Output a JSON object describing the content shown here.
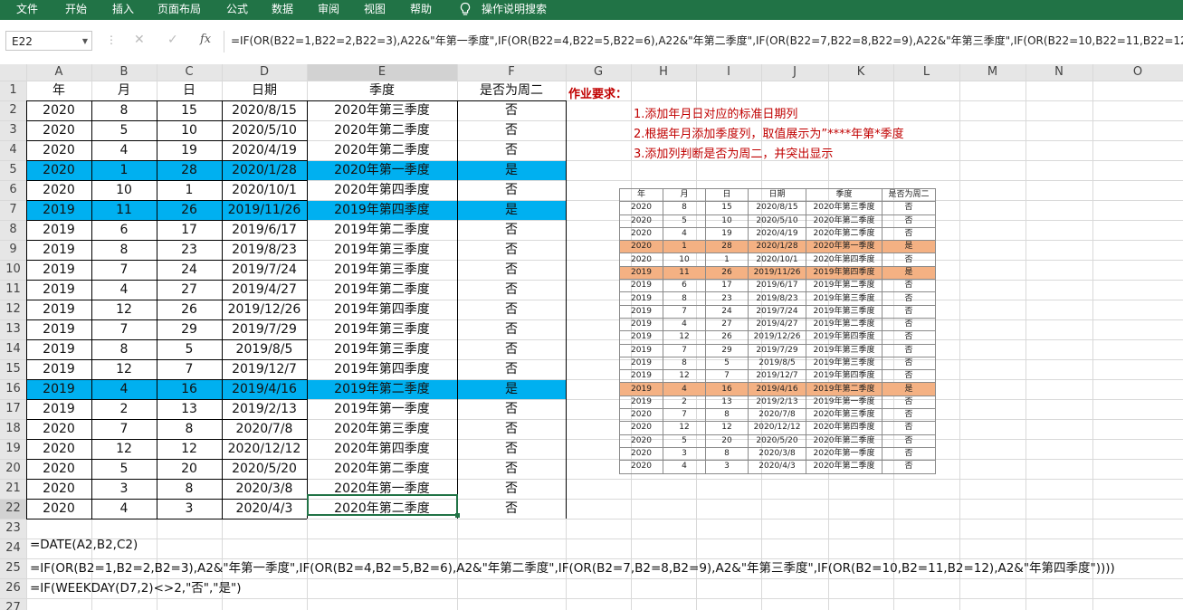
{
  "ribbon": {
    "tabs": [
      "文件",
      "开始",
      "插入",
      "页面布局",
      "公式",
      "数据",
      "审阅",
      "视图",
      "帮助"
    ],
    "tell_me": "操作说明搜索"
  },
  "formula_bar": {
    "name_box": "E22",
    "fx_label": "fx",
    "formula": "=IF(OR(B22=1,B22=2,B22=3),A22&\"年第一季度\",IF(OR(B22=4,B22=5,B22=6),A22&\"年第二季度\",IF(OR(B22=7,B22=8,B22=9),A22&\"年第三季度\",IF(OR(B22=10,B22=11,B22=12"
  },
  "columns": [
    "A",
    "B",
    "C",
    "D",
    "E",
    "F",
    "G",
    "H",
    "I",
    "J",
    "K",
    "L",
    "M",
    "N",
    "O"
  ],
  "row_numbers": [
    "1",
    "2",
    "3",
    "4",
    "5",
    "6",
    "7",
    "8",
    "9",
    "10",
    "11",
    "12",
    "13",
    "14",
    "15",
    "16",
    "17",
    "18",
    "19",
    "20",
    "21",
    "22",
    "23",
    "24",
    "25",
    "26",
    "27"
  ],
  "colors": {
    "ribbon": "#217346",
    "highlight": "#00b0f0",
    "mini_highlight": "#f4b183",
    "requirement_text": "#c00000"
  },
  "table": {
    "headers": [
      "年",
      "月",
      "日",
      "日期",
      "季度",
      "是否为周二"
    ],
    "rows": [
      [
        "2020",
        "8",
        "15",
        "2020/8/15",
        "2020年第三季度",
        "否"
      ],
      [
        "2020",
        "5",
        "10",
        "2020/5/10",
        "2020年第二季度",
        "否"
      ],
      [
        "2020",
        "4",
        "19",
        "2020/4/19",
        "2020年第二季度",
        "否"
      ],
      [
        "2020",
        "1",
        "28",
        "2020/1/28",
        "2020年第一季度",
        "是"
      ],
      [
        "2020",
        "10",
        "1",
        "2020/10/1",
        "2020年第四季度",
        "否"
      ],
      [
        "2019",
        "11",
        "26",
        "2019/11/26",
        "2019年第四季度",
        "是"
      ],
      [
        "2019",
        "6",
        "17",
        "2019/6/17",
        "2019年第二季度",
        "否"
      ],
      [
        "2019",
        "8",
        "23",
        "2019/8/23",
        "2019年第三季度",
        "否"
      ],
      [
        "2019",
        "7",
        "24",
        "2019/7/24",
        "2019年第三季度",
        "否"
      ],
      [
        "2019",
        "4",
        "27",
        "2019/4/27",
        "2019年第二季度",
        "否"
      ],
      [
        "2019",
        "12",
        "26",
        "2019/12/26",
        "2019年第四季度",
        "否"
      ],
      [
        "2019",
        "7",
        "29",
        "2019/7/29",
        "2019年第三季度",
        "否"
      ],
      [
        "2019",
        "8",
        "5",
        "2019/8/5",
        "2019年第三季度",
        "否"
      ],
      [
        "2019",
        "12",
        "7",
        "2019/12/7",
        "2019年第四季度",
        "否"
      ],
      [
        "2019",
        "4",
        "16",
        "2019/4/16",
        "2019年第二季度",
        "是"
      ],
      [
        "2019",
        "2",
        "13",
        "2019/2/13",
        "2019年第一季度",
        "否"
      ],
      [
        "2020",
        "7",
        "8",
        "2020/7/8",
        "2020年第三季度",
        "否"
      ],
      [
        "2020",
        "12",
        "12",
        "2020/12/12",
        "2020年第四季度",
        "否"
      ],
      [
        "2020",
        "5",
        "20",
        "2020/5/20",
        "2020年第二季度",
        "否"
      ],
      [
        "2020",
        "3",
        "8",
        "2020/3/8",
        "2020年第一季度",
        "否"
      ],
      [
        "2020",
        "4",
        "3",
        "2020/4/3",
        "2020年第二季度",
        "否"
      ]
    ]
  },
  "requirements": {
    "title": "作业要求：",
    "items": [
      "1.添加年月日对应的标准日期列",
      "2.根据年月添加季度列，取值展示为”****年第*季度",
      "3.添加列判断是否为周二，并突出显示"
    ]
  },
  "notes": [
    "=DATE(A2,B2,C2)",
    "=IF(OR(B2=1,B2=2,B2=3),A2&\"年第一季度\",IF(OR(B2=4,B2=5,B2=6),A2&\"年第二季度\",IF(OR(B2=7,B2=8,B2=9),A2&\"年第三季度\",IF(OR(B2=10,B2=11,B2=12),A2&\"年第四季度\"))))",
    "=IF(WEEKDAY(D7,2)<>2,\"否\",\"是\")"
  ]
}
